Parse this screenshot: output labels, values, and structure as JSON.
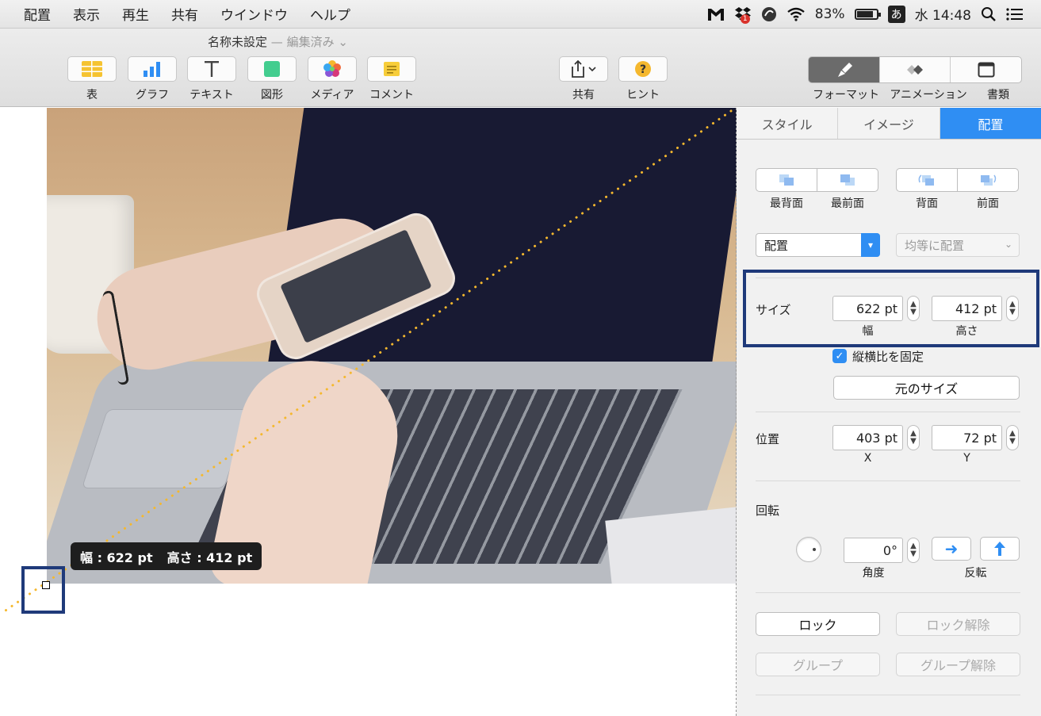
{
  "menubar": {
    "items": [
      "配置",
      "表示",
      "再生",
      "共有",
      "ウインドウ",
      "ヘルプ"
    ],
    "battery_percent": "83%",
    "ime": "あ",
    "clock": "水 14:48",
    "notification_badge": "1"
  },
  "toolbar": {
    "doc_title": "名称未設定",
    "doc_subtitle": "— 編集済み ⌄",
    "buttons": [
      {
        "label": "表"
      },
      {
        "label": "グラフ"
      },
      {
        "label": "テキスト"
      },
      {
        "label": "図形"
      },
      {
        "label": "メディア"
      },
      {
        "label": "コメント"
      },
      {
        "label": "共有"
      },
      {
        "label": "ヒント"
      }
    ],
    "segments": [
      {
        "label": "フォーマット"
      },
      {
        "label": "アニメーション"
      },
      {
        "label": "書類"
      }
    ]
  },
  "canvas": {
    "tooltip_width": "幅 : 622 pt",
    "tooltip_height": "高さ : 412 pt"
  },
  "inspector": {
    "tabs": [
      "スタイル",
      "イメージ",
      "配置"
    ],
    "layer_buttons": [
      "最背面",
      "最前面",
      "背面",
      "前面"
    ],
    "align_select": "配置",
    "distribute_select": "均等に配置",
    "size_label": "サイズ",
    "width_value": "622 pt",
    "width_caption": "幅",
    "height_value": "412 pt",
    "height_caption": "高さ",
    "constrain_label": "縦横比を固定",
    "original_size_button": "元のサイズ",
    "position_label": "位置",
    "x_value": "403 pt",
    "x_caption": "X",
    "y_value": "72 pt",
    "y_caption": "Y",
    "rotate_label": "回転",
    "angle_value": "0°",
    "angle_caption": "角度",
    "flip_caption": "反転",
    "lock_button": "ロック",
    "unlock_button": "ロック解除",
    "group_button": "グループ",
    "ungroup_button": "グループ解除"
  },
  "colors": {
    "accent": "#2f8ef3",
    "highlight_box": "#1f3a7a",
    "guide_line": "#f5b82e"
  }
}
